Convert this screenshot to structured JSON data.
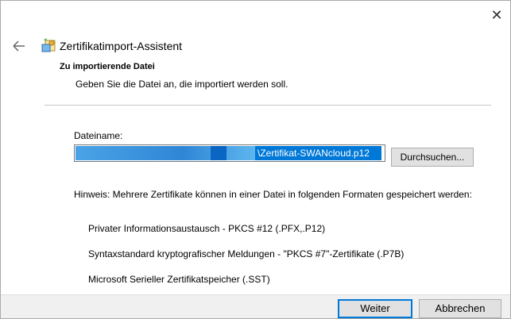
{
  "window": {
    "close_glyph": "✕"
  },
  "header": {
    "back_icon": "back-arrow-icon",
    "wizard_icon": "certificate-wizard-icon",
    "title": "Zertifikatimport-Assistent"
  },
  "section": {
    "heading": "Zu importierende Datei",
    "subheading": "Geben Sie die Datei an, die importiert werden soll."
  },
  "file": {
    "label": "Dateiname:",
    "value_visible": "\\Zertifikat-SWANcloud.p12",
    "browse_label": "Durchsuchen..."
  },
  "hint": {
    "text": "Hinweis: Mehrere Zertifikate können in einer Datei in folgenden Formaten gespeichert werden:",
    "formats": [
      "Privater Informationsaustausch - PKCS #12 (.PFX,.P12)",
      "Syntaxstandard kryptografischer Meldungen - \"PKCS #7\"-Zertifikate (.P7B)",
      "Microsoft Serieller Zertifikatspeicher (.SST)"
    ]
  },
  "footer": {
    "next_label": "Weiter",
    "cancel_label": "Abbrechen"
  },
  "colors": {
    "accent": "#0078d7",
    "footer_bg": "#f0f0f0",
    "button_bg": "#e1e1e1"
  }
}
